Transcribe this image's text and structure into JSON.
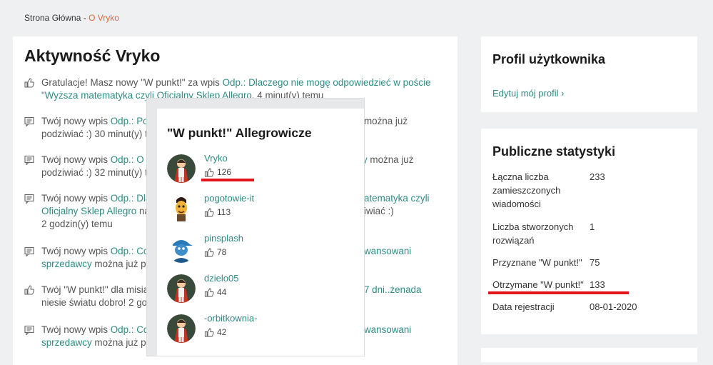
{
  "breadcrumb": {
    "home": "Strona Główna",
    "sep": "-",
    "current": "O Vryko"
  },
  "main": {
    "title": "Aktywność Vryko",
    "activities": [
      {
        "icon": "thumb-up-icon",
        "pre": "Gratulacje! Masz nowy \"W punkt!\" za wpis ",
        "link": "Odp.: Dlaczego nie mogę odpowiedzieć w poście \"Wyższa matematyka czyli Oficjalny Sklep Allegro",
        "post": ". 4 minut(y) temu"
      },
      {
        "icon": "message-icon",
        "pre": "Twój nowy wpis ",
        "link": "Odp.: Pot",
        "post": "",
        "line2": "podziwiać :) 30 minut(y) te",
        "tail": "można już"
      },
      {
        "icon": "message-icon",
        "pre": "Twój nowy wpis ",
        "link": "Odp.: O A",
        "post": "",
        "line2": "podziwiać :) 32 minut(y) te",
        "tail": "y można już"
      },
      {
        "icon": "message-icon",
        "pre": "Twój nowy wpis ",
        "link": "Odp.: Dla",
        "post": "",
        "line2a": "Oficjalny Sklep Allegro",
        "line2b": " na",
        "line3": "2 godzin(y) temu",
        "tail_link": "atematyka czyli",
        "tail2": "iwiać :)"
      },
      {
        "icon": "message-icon",
        "pre": "Twój nowy wpis ",
        "link": "Odp.: Co",
        "post": "",
        "line2a": "sprzedawcy",
        "line2b": " można już p",
        "tail_link": "wansowani"
      },
      {
        "icon": "thumb-up-icon",
        "pre": "Twój \"W punkt!\" dla misia",
        "link": "",
        "post": "",
        "line2": "niesie światu dobro! 2 god",
        "tail_link": "7 dni..żenada"
      },
      {
        "icon": "message-icon",
        "pre": "Twój nowy wpis ",
        "link": "Odp.: Co",
        "post": "",
        "line2a": "sprzedawcy",
        "line2b": " można już p",
        "tail_link": "wansowani"
      }
    ]
  },
  "popup": {
    "title": "\"W punkt!\" Allegrowicze",
    "users": [
      {
        "name": "Vryko",
        "count": "126",
        "avatar": "allegro-mascot-avatar"
      },
      {
        "name": "pogotowie-it",
        "count": "113",
        "avatar": "cartoon-face-avatar"
      },
      {
        "name": "pinsplash",
        "count": "78",
        "avatar": "blue-cap-avatar"
      },
      {
        "name": "dzielo05",
        "count": "44",
        "avatar": "allegro-mascot-avatar"
      },
      {
        "name": "-orbitkownia-",
        "count": "42",
        "avatar": "allegro-mascot-avatar"
      }
    ]
  },
  "profile": {
    "title": "Profil użytkownika",
    "edit_link": "Edytuj mój profil ›"
  },
  "stats": {
    "title": "Publiczne statystyki",
    "rows": [
      {
        "label": "Łączna liczba zamieszczonych wiadomości",
        "value": "233"
      },
      {
        "label": "Liczba stworzonych rozwiązań",
        "value": "1"
      },
      {
        "label": "Przyznane \"W punkt!\"",
        "value": "75"
      },
      {
        "label": "Otrzymane \"W punkt!\"",
        "value": "133"
      },
      {
        "label": "Data rejestracji",
        "value": "08-01-2020"
      }
    ]
  },
  "colors": {
    "accent": "#2e8b85",
    "breadcrumb_current": "#e4673a",
    "highlight": "#e3151c"
  }
}
